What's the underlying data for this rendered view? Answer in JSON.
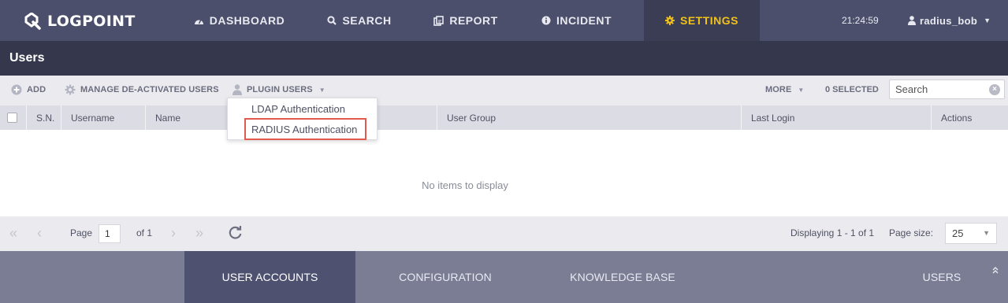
{
  "topnav": {
    "brand": "LOGPOINT",
    "items": [
      {
        "label": "DASHBOARD",
        "icon": "dashboard-icon"
      },
      {
        "label": "SEARCH",
        "icon": "search-icon"
      },
      {
        "label": "REPORT",
        "icon": "report-icon"
      },
      {
        "label": "INCIDENT",
        "icon": "info-icon"
      },
      {
        "label": "SETTINGS",
        "icon": "gear-icon",
        "active": true
      }
    ],
    "clock": "21:24:59",
    "user": "radius_bob"
  },
  "page": {
    "title": "Users"
  },
  "toolbar": {
    "add": "ADD",
    "manage_deactivated": "MANAGE DE-ACTIVATED USERS",
    "plugin_users": "PLUGIN USERS",
    "more": "MORE",
    "selected": "0 SELECTED",
    "search_placeholder": "Search"
  },
  "plugin_menu": {
    "items": [
      "LDAP Authentication",
      "RADIUS Authentication"
    ],
    "highlighted": "RADIUS Authentication"
  },
  "table": {
    "columns": [
      "S.N.",
      "Username",
      "Name",
      "User Group",
      "Last Login",
      "Actions"
    ],
    "rows": [],
    "empty_text": "No items to display"
  },
  "pager": {
    "page_label": "Page",
    "page_value": "1",
    "of_label": "of 1",
    "displaying": "Displaying 1 - 1 of 1",
    "page_size_label": "Page size:",
    "page_size": "25"
  },
  "bottomnav": {
    "items": [
      {
        "label": "USER ACCOUNTS",
        "active": true
      },
      {
        "label": "CONFIGURATION"
      },
      {
        "label": "KNOWLEDGE BASE"
      },
      {
        "label": "USERS"
      }
    ]
  },
  "colors": {
    "topnav_bg": "#4b4f6b",
    "titlebar_bg": "#35384d",
    "settings_accent": "#f2c21b",
    "highlight_border": "#e05a4d",
    "bottomnav_bg": "#7a7d94",
    "bottomnav_active": "#4e5270"
  }
}
